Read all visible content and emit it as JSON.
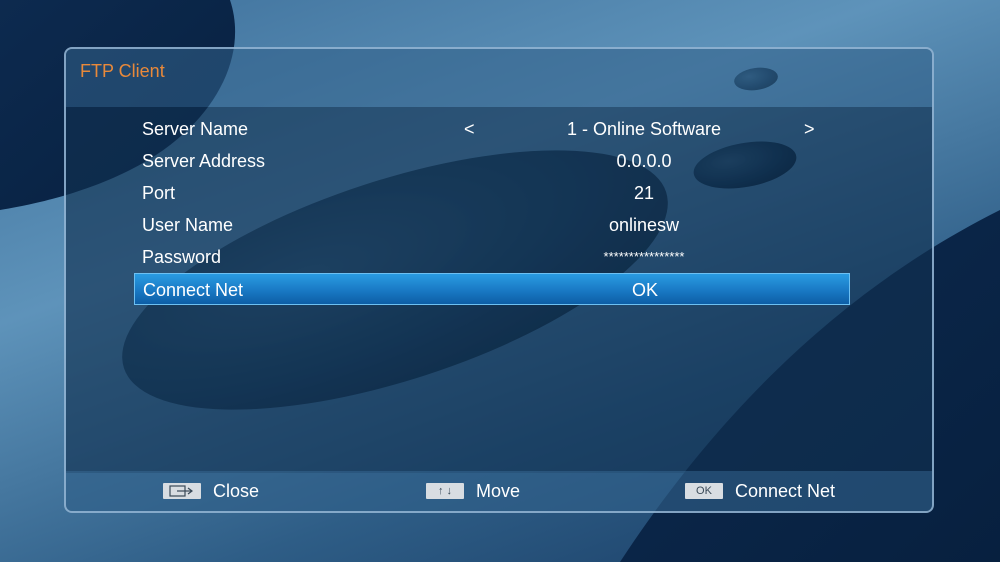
{
  "panel": {
    "title": "FTP Client"
  },
  "rows": [
    {
      "label": "Server Name",
      "value": "1 - Online Software",
      "prev_arrow": "<",
      "next_arrow": ">"
    },
    {
      "label": "Server Address",
      "value": "0.0.0.0"
    },
    {
      "label": "Port",
      "value": "21"
    },
    {
      "label": "User Name",
      "value": "onlinesw"
    },
    {
      "label": "Password",
      "value": "****************"
    },
    {
      "label": "Connect Net",
      "value": "OK",
      "selected": true
    }
  ],
  "footer": {
    "close": {
      "icon": "exit-arrow-icon",
      "label": "Close"
    },
    "move": {
      "icon_text": "↑ ↓",
      "label": "Move"
    },
    "connect": {
      "key": "OK",
      "label": "Connect Net"
    }
  },
  "colors": {
    "title": "#e8893a",
    "selection": "#1979c4",
    "text": "#ffffff"
  }
}
